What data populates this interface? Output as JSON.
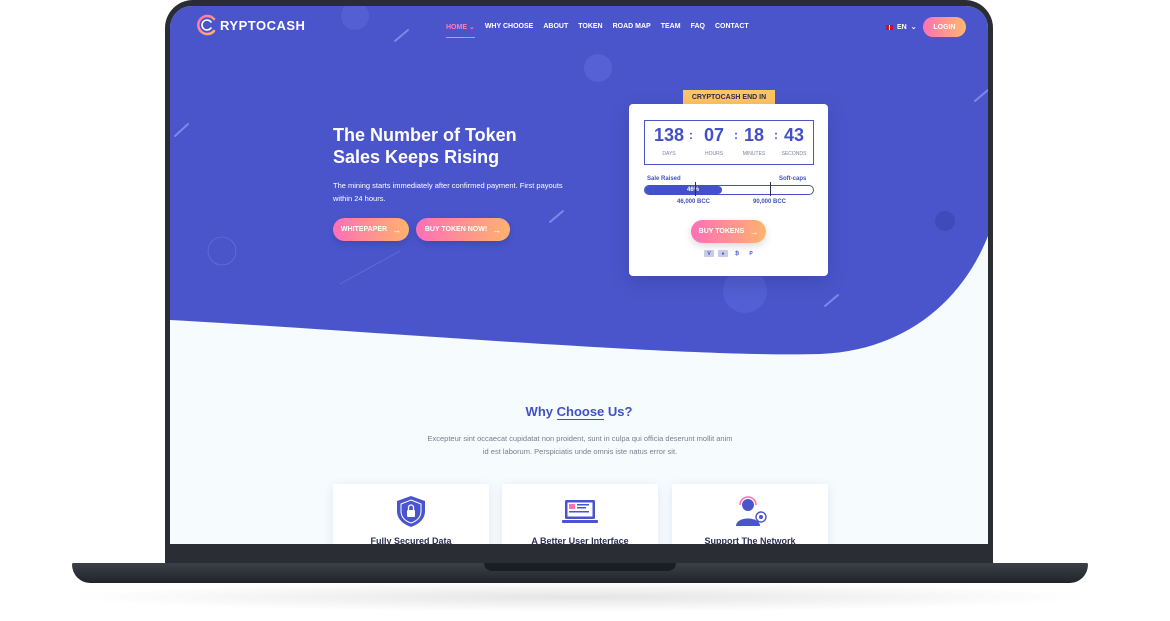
{
  "brand": {
    "name": "RYPTOCASH"
  },
  "nav": {
    "items": [
      "HOME",
      "WHY CHOOSE",
      "ABOUT",
      "TOKEN",
      "ROAD MAP",
      "TEAM",
      "FAQ",
      "CONTACT"
    ],
    "language": "EN",
    "login": "LOGIN"
  },
  "hero": {
    "title_line1": "The Number of Token",
    "title_line2": "Sales Keeps Rising",
    "subtitle": "The mining starts immediately after confirmed payment. First payouts within 24 hours.",
    "whitepaper_button": "WHITEPAPER",
    "buy_button": "BUY TOKEN NOW!"
  },
  "countdown": {
    "tab": "CRYPTOCASH END IN",
    "days": "138",
    "days_label": "DAYS",
    "hours": "07",
    "hours_label": "HOURS",
    "minutes": "18",
    "minutes_label": "MINUTES",
    "seconds": "43",
    "seconds_label": "SECONDS",
    "sale_raised_label": "Sale Raised",
    "soft_caps_label": "Soft-caps",
    "progress_text": "46%",
    "progress_value": 0.46,
    "mark1": "46,000 BCC",
    "mark2": "90,000 BCC",
    "buy_tokens": "BUY TOKENS",
    "payment_icons": [
      "visa-icon",
      "mastercard-icon",
      "bitcoin-icon",
      "paypal-icon"
    ]
  },
  "why": {
    "title_pre": "Why ",
    "title_hl": "Choose",
    "title_post": " Us?",
    "desc_line1": "Excepteur sint occaecat cupidatat non proident, sunt in culpa qui officia deserunt mollit anim",
    "desc_line2": "id est laborum. Perspiciatis unde omnis iste natus error sit.",
    "features": [
      {
        "title": "Fully Secured Data",
        "icon": "shield-lock-icon"
      },
      {
        "title": "A Better User Interface",
        "icon": "monitor-icon"
      },
      {
        "title": "Support The Network",
        "icon": "support-agent-icon"
      }
    ]
  },
  "colors": {
    "primary": "#4a55cc",
    "accent_pink": "#ff6fb6",
    "accent_orange": "#ffb36d",
    "tab_yellow": "#ffc463"
  }
}
